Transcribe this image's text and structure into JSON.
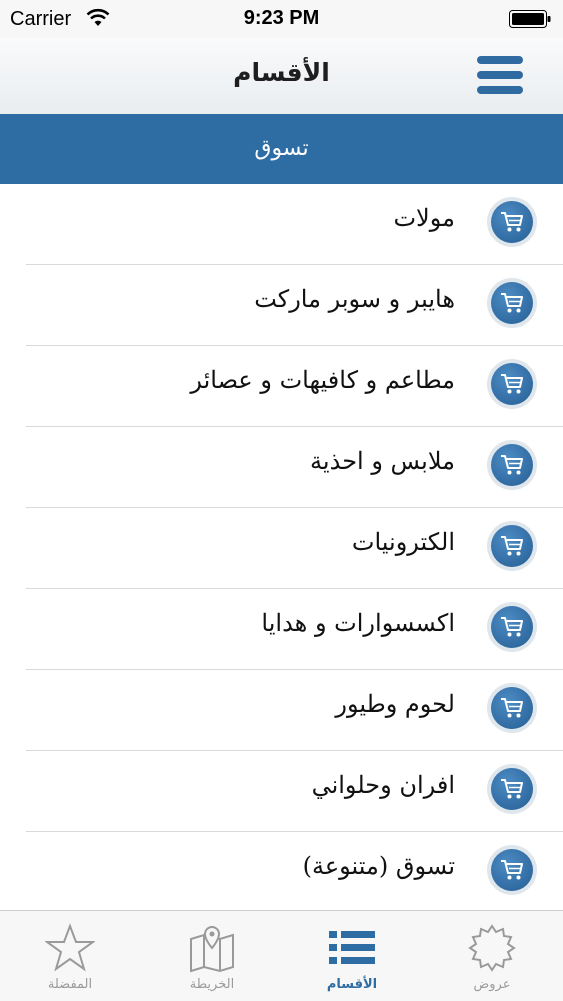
{
  "status_bar": {
    "carrier": "Carrier",
    "time": "9:23 PM"
  },
  "nav": {
    "title": "الأقسام",
    "menu_icon": "hamburger-icon"
  },
  "section": {
    "title": "تسوق"
  },
  "list": {
    "item_icon": "shopping-cart-icon",
    "items": [
      {
        "label": "مولات"
      },
      {
        "label": "هايبر و سوبر ماركت"
      },
      {
        "label": "مطاعم و كافيهات و عصائر"
      },
      {
        "label": "ملابس و احذية"
      },
      {
        "label": "الكترونيات"
      },
      {
        "label": "اكسسوارات و هدايا"
      },
      {
        "label": "لحوم وطيور"
      },
      {
        "label": "افران وحلواني"
      },
      {
        "label": "تسوق (متنوعة)"
      }
    ]
  },
  "tab_bar": {
    "tabs": [
      {
        "label": "المفضلة",
        "icon": "star-icon",
        "active": false
      },
      {
        "label": "الخريطة",
        "icon": "map-icon",
        "active": false
      },
      {
        "label": "الأقسام",
        "icon": "list-icon",
        "active": true
      },
      {
        "label": "عروض",
        "icon": "badge-icon",
        "active": false
      }
    ]
  },
  "colors": {
    "accent": "#2e6da4",
    "inactive": "#9a9a9a"
  }
}
